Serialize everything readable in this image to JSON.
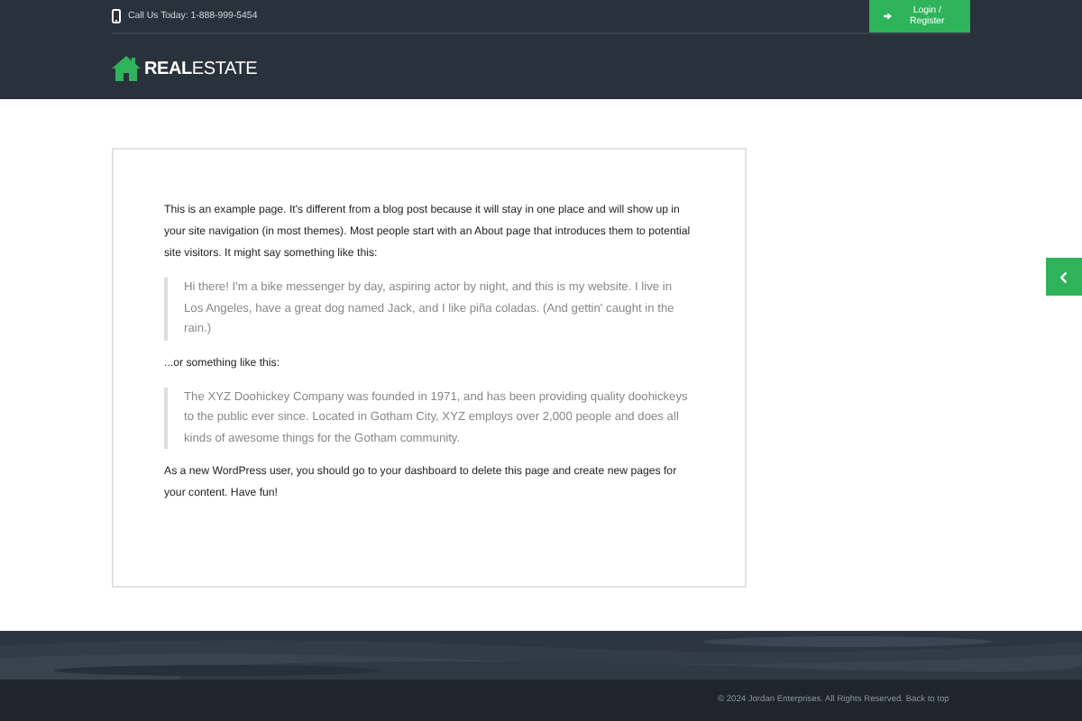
{
  "top_bar": {
    "phone": "Call Us Today: 1-888-999-5454",
    "login_button": "Login / Register"
  },
  "logo": "**REAL**ESTATE",
  "content": [
    {
      "kind": "paragraph",
      "text": "This is an example page. It's different from a blog post because it will stay in one place and will show up in your site navigation (in most themes). Most people start with an About page that introduces them to potential site visitors. It might say something like this:"
    },
    {
      "kind": "quote",
      "text": "Hi there! I'm a bike messenger by day, aspiring actor by night, and this is my website. I live in Los Angeles, have a great dog named Jack, and I like piña coladas. (And gettin' caught in the rain.)"
    },
    {
      "kind": "paragraph",
      "text": "...or something like this:"
    },
    {
      "kind": "quote",
      "text": "The XYZ Doohickey Company was founded in 1971, and has been providing quality doohickeys to the public ever since. Located in Gotham City, XYZ employs over 2,000 people and does all kinds of awesome things for the Gotham community."
    },
    {
      "kind": "paragraph",
      "text": "As a new WordPress user, you should go to your dashboard to delete this page and create new pages for your content. Have fun!"
    }
  ],
  "footer": {
    "copyright": "© 2024 Jordan Enterprises. All Rights Reserved. Back to top"
  }
}
